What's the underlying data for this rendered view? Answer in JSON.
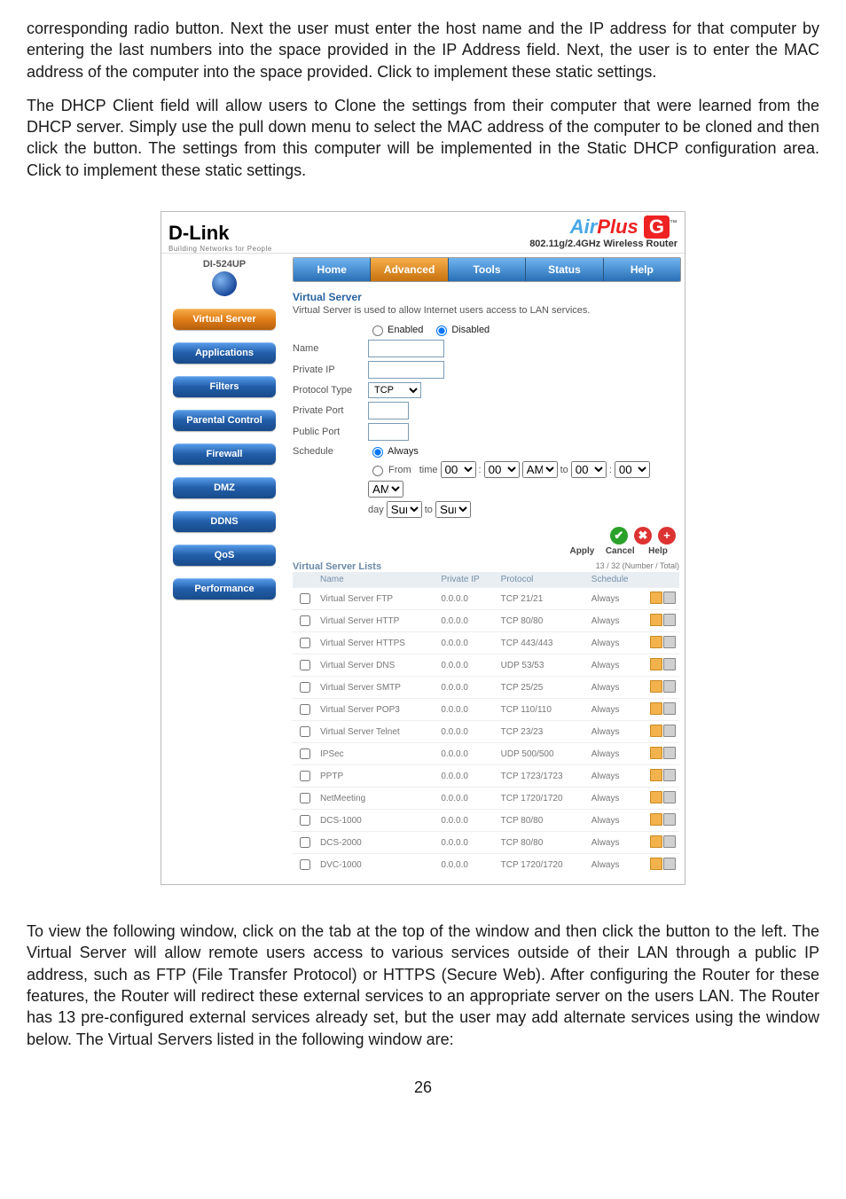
{
  "doc": {
    "para1": "corresponding               radio button. Next the user must enter the host name and the IP address for that computer by entering the last numbers into the space provided in the IP Address field. Next, the user is to enter the MAC address of the computer into the space provided. Click           to implement these static settings.",
    "para2": "The DHCP Client field will allow users to Clone the settings from their computer that were learned from the DHCP server. Simply use the pull down menu to select the MAC address of the computer to be cloned and then click the          button. The settings from this computer will be implemented in the Static DHCP configuration area. Click          to implement these static settings.",
    "para3": "To view the following window, click on the                   tab at the top of the window and then click the                        button to the left. The Virtual Server will allow remote users access to various services outside of their LAN through a public IP address, such as FTP (File Transfer Protocol) or HTTPS (Secure Web). After configuring the Router for these features, the Router will redirect these external services to an appropriate server on the users LAN. The Router has 13 pre-configured external services already set, but the user may add alternate services using the window below. The Virtual Servers listed in the following window are:"
  },
  "page_num": "26",
  "brand_title": "D-Link",
  "brand_tag": "Building Networks for People",
  "airplus_air": "Air",
  "airplus_plus": "Plus",
  "airplus_g": "G",
  "airplus_sub": "802.11g/2.4GHz Wireless Router",
  "model": "DI-524UP",
  "tabs": {
    "home": "Home",
    "adv": "Advanced",
    "tools": "Tools",
    "status": "Status",
    "help": "Help"
  },
  "side": {
    "virtual": "Virtual Server",
    "apps": "Applications",
    "filters": "Filters",
    "parental": "Parental Control",
    "firewall": "Firewall",
    "dmz": "DMZ",
    "ddns": "DDNS",
    "qos": "QoS",
    "perf": "Performance"
  },
  "form": {
    "title": "Virtual Server",
    "desc": "Virtual Server is used to allow Internet users access to LAN services.",
    "enabled": "Enabled",
    "disabled": "Disabled",
    "name": "Name",
    "private_ip": "Private IP",
    "prot_type": "Protocol Type",
    "tcp": "TCP",
    "private_port": "Private Port",
    "public_port": "Public Port",
    "schedule": "Schedule",
    "always": "Always",
    "from": "From",
    "time": "time",
    "am": "AM",
    "to": "to",
    "day": "day",
    "sun": "Sun",
    "zero": "00"
  },
  "actions": {
    "apply": "Apply",
    "cancel": "Cancel",
    "help": "Help",
    "icon_ok": "✔",
    "icon_no": "✖",
    "icon_add": "+"
  },
  "list_header": {
    "title": "Virtual Server Lists",
    "count": "13 / 32 (Number / Total)",
    "name": "Name",
    "ip": "Private IP",
    "prot": "Protocol",
    "sched": "Schedule"
  },
  "rows": [
    {
      "n": "Virtual Server FTP",
      "ip": "0.0.0.0",
      "p": "TCP 21/21",
      "s": "Always"
    },
    {
      "n": "Virtual Server HTTP",
      "ip": "0.0.0.0",
      "p": "TCP 80/80",
      "s": "Always"
    },
    {
      "n": "Virtual Server HTTPS",
      "ip": "0.0.0.0",
      "p": "TCP 443/443",
      "s": "Always"
    },
    {
      "n": "Virtual Server DNS",
      "ip": "0.0.0.0",
      "p": "UDP 53/53",
      "s": "Always"
    },
    {
      "n": "Virtual Server SMTP",
      "ip": "0.0.0.0",
      "p": "TCP 25/25",
      "s": "Always"
    },
    {
      "n": "Virtual Server POP3",
      "ip": "0.0.0.0",
      "p": "TCP 110/110",
      "s": "Always"
    },
    {
      "n": "Virtual Server Telnet",
      "ip": "0.0.0.0",
      "p": "TCP 23/23",
      "s": "Always"
    },
    {
      "n": "IPSec",
      "ip": "0.0.0.0",
      "p": "UDP 500/500",
      "s": "Always"
    },
    {
      "n": "PPTP",
      "ip": "0.0.0.0",
      "p": "TCP 1723/1723",
      "s": "Always"
    },
    {
      "n": "NetMeeting",
      "ip": "0.0.0.0",
      "p": "TCP 1720/1720",
      "s": "Always"
    },
    {
      "n": "DCS-1000",
      "ip": "0.0.0.0",
      "p": "TCP 80/80",
      "s": "Always"
    },
    {
      "n": "DCS-2000",
      "ip": "0.0.0.0",
      "p": "TCP 80/80",
      "s": "Always"
    },
    {
      "n": "DVC-1000",
      "ip": "0.0.0.0",
      "p": "TCP 1720/1720",
      "s": "Always"
    }
  ]
}
